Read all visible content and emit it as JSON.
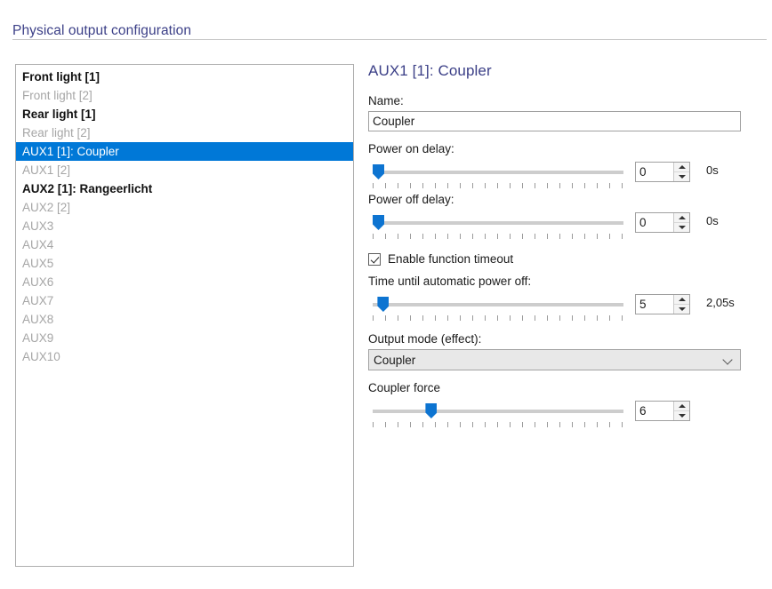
{
  "groupbox": {
    "title": "Physical output configuration"
  },
  "output_list": {
    "items": [
      {
        "label": "Front light [1]",
        "state": "bold",
        "selected": false
      },
      {
        "label": "Front light [2]",
        "state": "dim",
        "selected": false
      },
      {
        "label": "Rear light [1]",
        "state": "bold",
        "selected": false
      },
      {
        "label": "Rear light [2]",
        "state": "dim",
        "selected": false
      },
      {
        "label": "AUX1 [1]: Coupler",
        "state": "normal",
        "selected": true
      },
      {
        "label": "AUX1 [2]",
        "state": "dim",
        "selected": false
      },
      {
        "label": "AUX2 [1]: Rangeerlicht",
        "state": "bold",
        "selected": false
      },
      {
        "label": "AUX2 [2]",
        "state": "dim",
        "selected": false
      },
      {
        "label": "AUX3",
        "state": "dim",
        "selected": false
      },
      {
        "label": "AUX4",
        "state": "dim",
        "selected": false
      },
      {
        "label": "AUX5",
        "state": "dim",
        "selected": false
      },
      {
        "label": "AUX6",
        "state": "dim",
        "selected": false
      },
      {
        "label": "AUX7",
        "state": "dim",
        "selected": false
      },
      {
        "label": "AUX8",
        "state": "dim",
        "selected": false
      },
      {
        "label": "AUX9",
        "state": "dim",
        "selected": false
      },
      {
        "label": "AUX10",
        "state": "dim",
        "selected": false
      }
    ]
  },
  "detail": {
    "title": "AUX1 [1]: Coupler",
    "name_label": "Name:",
    "name_value": "Coupler",
    "name_placeholder": "",
    "power_on_delay": {
      "label": "Power on delay:",
      "value": "0",
      "unit": "0s",
      "percent": 0,
      "ticks": 21
    },
    "power_off_delay": {
      "label": "Power off delay:",
      "value": "0",
      "unit": "0s",
      "percent": 0,
      "ticks": 21
    },
    "enable_timeout": {
      "label": "Enable function timeout",
      "checked": true
    },
    "auto_power_off": {
      "label": "Time until automatic power off:",
      "value": "5",
      "unit": "2,05s",
      "percent": 2,
      "ticks": 21
    },
    "output_mode": {
      "label": "Output mode (effect):",
      "value": "Coupler",
      "chevron_icon": "chevron-down-icon"
    },
    "coupler_force": {
      "label": "Coupler force",
      "value": "6",
      "unit": "",
      "percent": 22,
      "ticks": 21
    }
  },
  "colors": {
    "header_text": "#3b3f87",
    "selection": "#0078d7",
    "slider_accent": "#0d74d1",
    "track": "#cdcdcd",
    "border": "#a0a0a0"
  }
}
